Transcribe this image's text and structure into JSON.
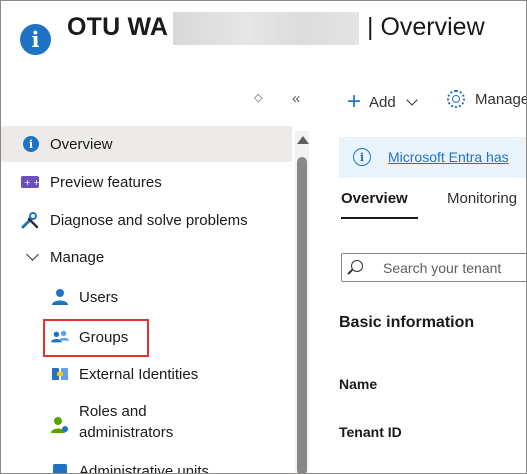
{
  "header": {
    "title_visible": "OTU WA",
    "title_suffix": "| Overview"
  },
  "sidebar": {
    "items": [
      {
        "label": "Overview",
        "icon": "info-icon",
        "active": true
      },
      {
        "label": "Preview features",
        "icon": "preview-features-icon"
      },
      {
        "label": "Diagnose and solve problems",
        "icon": "wrench-icon"
      },
      {
        "label": "Manage",
        "icon": "chevron-down-icon",
        "expanded": true
      },
      {
        "label": "Users",
        "icon": "user-icon"
      },
      {
        "label": "Groups",
        "icon": "groups-icon",
        "highlighted": true
      },
      {
        "label": "External Identities",
        "icon": "external-identities-icon"
      },
      {
        "label": "Roles and",
        "label2": "administrators",
        "icon": "roles-icon"
      },
      {
        "label": "Administrative units",
        "icon": "admin-units-icon"
      }
    ]
  },
  "toolbar": {
    "add_label": "Add",
    "manage_label": "Manage"
  },
  "banner": {
    "link_text": "Microsoft Entra has"
  },
  "tabs": [
    {
      "label": "Overview",
      "active": true
    },
    {
      "label": "Monitoring"
    }
  ],
  "search": {
    "placeholder": "Search your tenant"
  },
  "basic_info": {
    "title": "Basic information",
    "fields": [
      "Name",
      "Tenant ID"
    ]
  },
  "colors": {
    "accent": "#1f72c4",
    "highlight_border": "#e0342f",
    "active_bg": "#edebe9",
    "banner_bg": "#e8f3fc"
  }
}
